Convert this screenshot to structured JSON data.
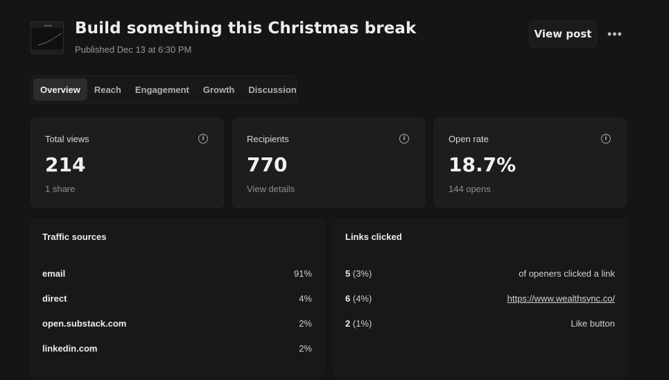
{
  "post": {
    "title": "Build something this Christmas break",
    "published": "Published Dec 13 at 6:30 PM",
    "view_post_label": "View post",
    "more_label": "•••"
  },
  "tabs": [
    {
      "label": "Overview",
      "active": true
    },
    {
      "label": "Reach",
      "active": false
    },
    {
      "label": "Engagement",
      "active": false
    },
    {
      "label": "Growth",
      "active": false
    },
    {
      "label": "Discussion",
      "active": false
    }
  ],
  "stats": [
    {
      "label": "Total views",
      "value": "214",
      "sub": "1 share",
      "icon": "info-icon"
    },
    {
      "label": "Recipients",
      "value": "770",
      "sub": "View details",
      "icon": "info-icon"
    },
    {
      "label": "Open rate",
      "value": "18.7%",
      "sub": "144 opens",
      "icon": "info-icon"
    }
  ],
  "traffic": {
    "title": "Traffic sources",
    "rows": [
      {
        "name": "email",
        "pct": "91%"
      },
      {
        "name": "direct",
        "pct": "4%"
      },
      {
        "name": "open.substack.com",
        "pct": "2%"
      },
      {
        "name": "linkedin.com",
        "pct": "2%"
      }
    ]
  },
  "links": {
    "title": "Links clicked",
    "rows": [
      {
        "count": "5",
        "pct": "(3%)",
        "label": "of openers clicked a link",
        "is_link": false
      },
      {
        "count": "6",
        "pct": "(4%)",
        "label": "https://www.wealthsync.co/",
        "is_link": true
      },
      {
        "count": "2",
        "pct": "(1%)",
        "label": "Like button",
        "is_link": false
      }
    ]
  },
  "colors": {
    "background": "#151515",
    "card": "#1d1d1f",
    "text": "#ececec",
    "muted": "#8f8f8f"
  }
}
